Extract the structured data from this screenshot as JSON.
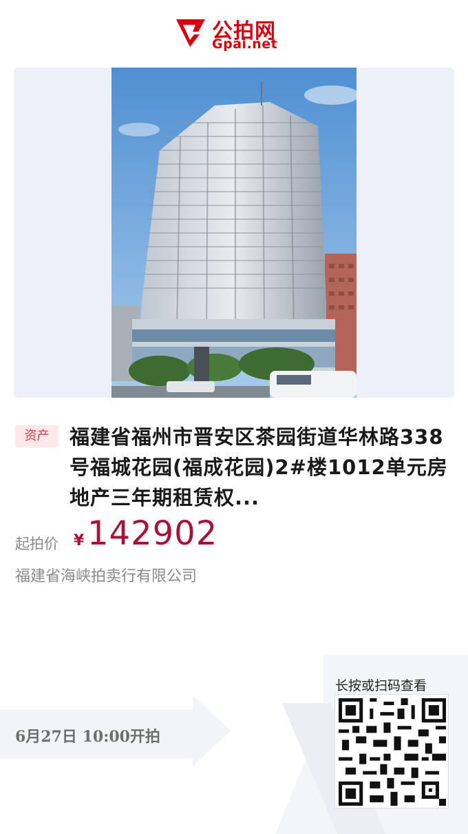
{
  "header": {
    "logo_cn": "公拍网",
    "logo_en": "Gpai.net",
    "brand_color": "#d7000f"
  },
  "listing": {
    "tag": "资产",
    "title": "福建省福州市晋安区茶园街道华林路338号福城花园(福成花园)2#楼1012单元房地产三年期租赁权...",
    "price_label": "起拍价",
    "currency": "¥",
    "price": "142902",
    "company": "福建省海峡拍卖行有限公司",
    "start_time": "6月27日  10:00开拍"
  },
  "qr": {
    "caption": "长按或扫码查看"
  },
  "colors": {
    "price": "#a8123a",
    "tag_bg": "#fde8eb",
    "tag_text": "#d7384c"
  }
}
